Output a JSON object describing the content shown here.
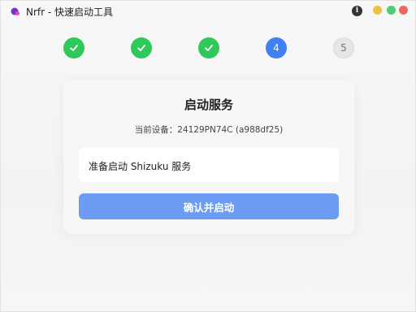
{
  "window": {
    "title": "Nrfr - 快速启动工具"
  },
  "titlebar": {
    "info_icon": "i",
    "buttons": [
      "minimize",
      "maximize",
      "close"
    ]
  },
  "stepper": {
    "steps": [
      {
        "label": "✓",
        "state": "done"
      },
      {
        "label": "✓",
        "state": "done"
      },
      {
        "label": "✓",
        "state": "done"
      },
      {
        "label": "4",
        "state": "active"
      },
      {
        "label": "5",
        "state": "pending"
      }
    ],
    "colors": {
      "done": "#2fc85a",
      "active": "#3f7ff2",
      "pending": "#e6e6e6"
    }
  },
  "card": {
    "title": "启动服务",
    "device_line": "当前设备：24129PN74C (a988df25)",
    "message": "准备启动 Shizuku 服务",
    "confirm_label": "确认并启动"
  },
  "colors": {
    "primary": "#6d9cf5",
    "success": "#2fc85a"
  }
}
